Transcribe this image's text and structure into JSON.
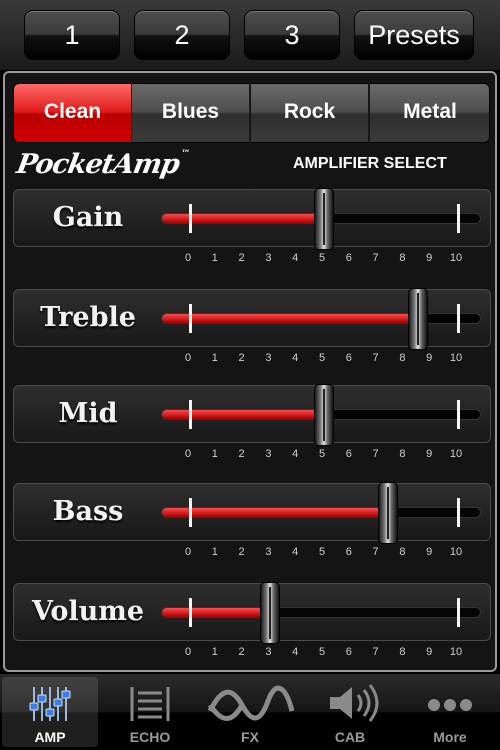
{
  "presets": {
    "buttons": [
      {
        "label": "1"
      },
      {
        "label": "2"
      },
      {
        "label": "3"
      },
      {
        "label": "Presets"
      }
    ]
  },
  "amp_select": {
    "tabs": [
      {
        "label": "Clean",
        "selected": true
      },
      {
        "label": "Blues",
        "selected": false
      },
      {
        "label": "Rock",
        "selected": false
      },
      {
        "label": "Metal",
        "selected": false
      }
    ],
    "logo_text": "PocketAmp",
    "logo_tm": "™",
    "heading": "AMPLIFIER SELECT"
  },
  "knobs": [
    {
      "label": "Gain",
      "value": 5.0
    },
    {
      "label": "Treble",
      "value": 8.5
    },
    {
      "label": "Mid",
      "value": 5.0
    },
    {
      "label": "Bass",
      "value": 7.4
    },
    {
      "label": "Volume",
      "value": 3.0
    }
  ],
  "scale_labels": [
    "0",
    "1",
    "2",
    "3",
    "4",
    "5",
    "6",
    "7",
    "8",
    "9",
    "10"
  ],
  "colors": {
    "accent": "#e01a1a",
    "fill": "#c00000"
  },
  "tabbar": {
    "tabs": [
      {
        "label": "AMP",
        "icon": "sliders-icon",
        "selected": true
      },
      {
        "label": "ECHO",
        "icon": "echo-icon",
        "selected": false
      },
      {
        "label": "FX",
        "icon": "wave-icon",
        "selected": false
      },
      {
        "label": "CAB",
        "icon": "speaker-icon",
        "selected": false
      },
      {
        "label": "More",
        "icon": "more-icon",
        "selected": false
      }
    ]
  }
}
